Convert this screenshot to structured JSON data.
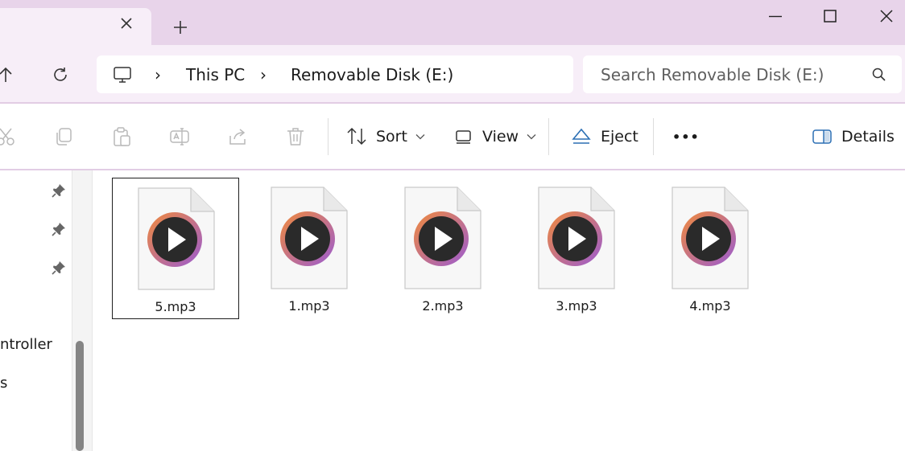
{
  "window": {
    "new_tab_symbol": "+",
    "controls": [
      "minimize-icon",
      "maximize-icon",
      "close-icon"
    ]
  },
  "address": {
    "segments": [
      "This PC",
      "Removable Disk (E:)"
    ],
    "separator": "›"
  },
  "search": {
    "placeholder": "Search Removable Disk (E:)"
  },
  "toolbar": {
    "icons": [
      "cut-icon",
      "copy-icon",
      "paste-icon",
      "rename-icon",
      "share-icon",
      "delete-icon"
    ],
    "sort_label": "Sort",
    "view_label": "View",
    "eject_label": "Eject",
    "more_label": "•••",
    "details_label": "Details"
  },
  "sidebar": {
    "items": [
      "ntroller",
      "s"
    ]
  },
  "files": [
    {
      "name": "5.mp3",
      "selected": true
    },
    {
      "name": "1.mp3",
      "selected": false
    },
    {
      "name": "2.mp3",
      "selected": false
    },
    {
      "name": "3.mp3",
      "selected": false
    },
    {
      "name": "4.mp3",
      "selected": false
    }
  ],
  "colors": {
    "titlebar": "#e8d4ea",
    "addressbar": "#f7eef8",
    "eject_accent": "#2b6fb4",
    "media_ring_start": "#f08a3c",
    "media_ring_end": "#9b5bd1"
  }
}
